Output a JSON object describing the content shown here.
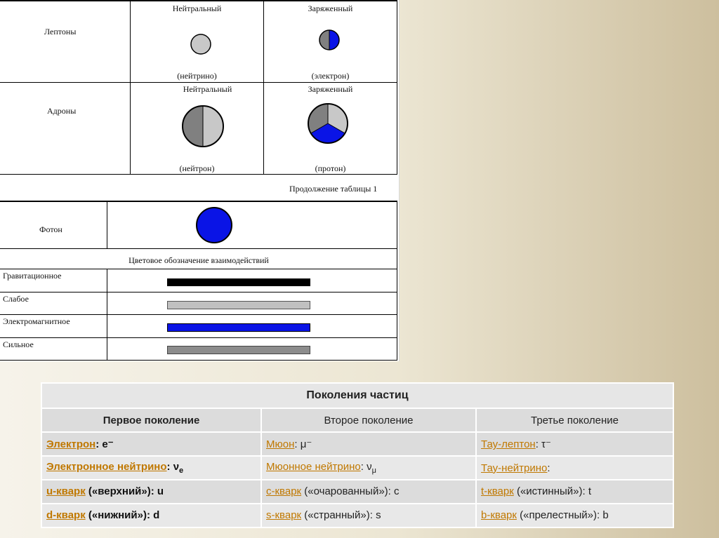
{
  "upper_table": {
    "row_leptons": {
      "label": "Лептоны",
      "neutral_header": "Нейтральный",
      "charged_header": "Заряженный",
      "neutral_caption": "(нейтрино)",
      "charged_caption": "(электрон)"
    },
    "row_hadrons": {
      "label": "Адроны",
      "neutral_header": "Нейтральный",
      "charged_header": "Заряженный",
      "neutral_caption": "(нейтрон)",
      "charged_caption": "(протон)"
    },
    "continuation": "Продолжение таблицы 1",
    "photon_label": "Фотон",
    "interactions_title": "Цветовое обозначение взаимодействий",
    "interactions": [
      {
        "label": "Гравитационное",
        "color": "#000000"
      },
      {
        "label": "Слабое",
        "color": "#c0c0c0"
      },
      {
        "label": "Электромагнитное",
        "color": "#0a14e6"
      },
      {
        "label": "Сильное",
        "color": "#8c8c8c"
      }
    ],
    "colors": {
      "grey_light": "#c8c8c8",
      "grey_dark": "#808080",
      "blue": "#0a14e6"
    }
  },
  "generations": {
    "title": "Поколения частиц",
    "headers": [
      "Первое поколение",
      "Второе поколение",
      "Третье поколение"
    ],
    "rows": [
      [
        {
          "link": "Электрон",
          "text": ": e⁻"
        },
        {
          "link": "Мюон",
          "text": ": μ⁻"
        },
        {
          "link": "Тау-лептон",
          "text": ": τ⁻"
        }
      ],
      [
        {
          "link": "Электронное нейтрино",
          "text": ": ν",
          "sub": "e"
        },
        {
          "link": "Мюонное нейтрино",
          "text": ": ν",
          "sub": "μ"
        },
        {
          "link": "Тау-нейтрино",
          "text": ":"
        }
      ],
      [
        {
          "link": "u-кварк",
          "text": " («верхний»): u"
        },
        {
          "link": "c-кварк",
          "text": " («очарованный»): c"
        },
        {
          "link": "t-кварк",
          "text": " («истинный»): t"
        }
      ],
      [
        {
          "link": "d-кварк",
          "text": " («нижний»): d"
        },
        {
          "link": "s-кварк",
          "text": " («странный»): s"
        },
        {
          "link": "b-кварк",
          "text": " («прелестный»): b"
        }
      ]
    ],
    "link_color": "#c07800"
  }
}
